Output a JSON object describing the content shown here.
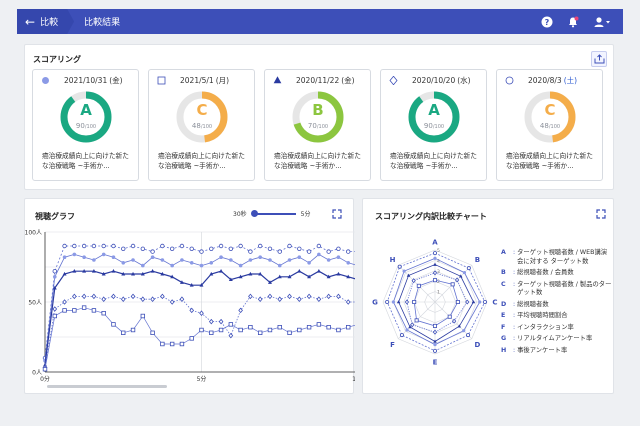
{
  "header": {
    "back_label": "比較",
    "current_label": "比較結果"
  },
  "scoring": {
    "title": "スコアリング",
    "cards": [
      {
        "marker": "dot",
        "date": "2021/10/31",
        "weekday": "(金)",
        "weekday_color": "#333333",
        "grade": "A",
        "score": "90",
        "max": "/100",
        "fraction": 0.9,
        "color": "#1aa882",
        "text": "癌治療成績向上に向けた新たな治療戦略 ~手術か..."
      },
      {
        "marker": "square",
        "date": "2021/5/1",
        "weekday": "(月)",
        "weekday_color": "#333333",
        "grade": "C",
        "score": "48",
        "max": "/100",
        "fraction": 0.48,
        "color": "#f4ad4a",
        "text": "癌治療成績向上に向けた新たな治療戦略 ~手術か..."
      },
      {
        "marker": "triangle",
        "date": "2020/11/22",
        "weekday": "(金)",
        "weekday_color": "#333333",
        "grade": "B",
        "score": "70",
        "max": "/100",
        "fraction": 0.7,
        "color": "#8cc63f",
        "text": "癌治療成績向上に向けた新たな治療戦略 ~手術か..."
      },
      {
        "marker": "diamond",
        "date": "2020/10/20",
        "weekday": "(水)",
        "weekday_color": "#333333",
        "grade": "A",
        "score": "90",
        "max": "/100",
        "fraction": 0.9,
        "color": "#1aa882",
        "text": "癌治療成績向上に向けた新たな治療戦略 ~手術か..."
      },
      {
        "marker": "circle",
        "date": "2020/8/3",
        "weekday": "(土)",
        "weekday_color": "#2a58d1",
        "grade": "C",
        "score": "48",
        "max": "/100",
        "fraction": 0.48,
        "color": "#f4ad4a",
        "text": "癌治療成績向上に向けた新たな治療戦略 ~手術か..."
      }
    ]
  },
  "graph": {
    "title": "視聴グラフ",
    "slider_min": "30秒",
    "slider_max": "5分"
  },
  "radar": {
    "title": "スコアリング内訳比較チャート",
    "legend": [
      {
        "key": "A",
        "text": "ターゲット視聴者数 / WEB講演会に対する ターゲット数"
      },
      {
        "key": "B",
        "text": "総視聴者数 / 会員数"
      },
      {
        "key": "C",
        "text": "ターゲット視聴者数 / 製品のターゲット数"
      },
      {
        "key": "D",
        "text": "総視聴者数"
      },
      {
        "key": "E",
        "text": "平均視聴時間割合"
      },
      {
        "key": "F",
        "text": "インタラクション率"
      },
      {
        "key": "G",
        "text": "リアルタイムアンケート率"
      },
      {
        "key": "H",
        "text": "事後アンケート率"
      }
    ]
  },
  "chart_data": [
    {
      "type": "line",
      "title": "視聴グラフ",
      "x_ticks": [
        "0分",
        "5分",
        "1"
      ],
      "y_ticks": [
        "0人",
        "50人",
        "100人"
      ],
      "ylim": [
        0,
        100
      ],
      "x_points": 33,
      "series": [
        {
          "marker": "circle",
          "values": [
            10,
            72,
            90,
            90,
            90,
            90,
            90,
            90,
            88,
            90,
            88,
            86,
            90,
            88,
            90,
            88,
            86,
            88,
            90,
            88,
            90,
            86,
            90,
            88,
            86,
            90,
            88,
            86,
            90,
            86,
            88,
            86,
            86
          ]
        },
        {
          "marker": "dot",
          "values": [
            8,
            68,
            82,
            84,
            82,
            80,
            84,
            82,
            78,
            80,
            76,
            82,
            80,
            76,
            80,
            78,
            76,
            78,
            82,
            80,
            76,
            80,
            82,
            80,
            76,
            80,
            82,
            78,
            84,
            80,
            82,
            78,
            76
          ]
        },
        {
          "marker": "triangle",
          "values": [
            5,
            60,
            70,
            72,
            72,
            72,
            70,
            72,
            70,
            70,
            70,
            72,
            70,
            68,
            64,
            62,
            62,
            70,
            72,
            66,
            68,
            70,
            70,
            64,
            68,
            68,
            72,
            68,
            72,
            68,
            70,
            68,
            66
          ]
        },
        {
          "marker": "diamond",
          "values": [
            3,
            45,
            50,
            54,
            54,
            54,
            52,
            54,
            52,
            54,
            52,
            52,
            54,
            50,
            52,
            44,
            42,
            36,
            36,
            26,
            44,
            54,
            52,
            54,
            52,
            54,
            52,
            54,
            52,
            54,
            54,
            50,
            50
          ]
        },
        {
          "marker": "square",
          "values": [
            2,
            40,
            44,
            44,
            46,
            44,
            42,
            34,
            28,
            30,
            40,
            28,
            20,
            20,
            20,
            24,
            30,
            28,
            30,
            34,
            30,
            32,
            28,
            30,
            32,
            28,
            30,
            32,
            34,
            32,
            30,
            32,
            34
          ]
        }
      ]
    },
    {
      "type": "radar",
      "title": "スコアリング内訳比較チャート",
      "axes": [
        "A",
        "B",
        "C",
        "D",
        "E",
        "F",
        "G",
        "H"
      ],
      "scale_labels": [
        "1",
        "2",
        "3",
        "4",
        "5"
      ],
      "rmax": 5,
      "series": [
        {
          "marker": "circle",
          "values": [
            4.7,
            4.6,
            4.8,
            4.5,
            4.7,
            4.5,
            4.6,
            4.8
          ]
        },
        {
          "marker": "dot",
          "values": [
            4.2,
            4.0,
            4.3,
            3.9,
            4.1,
            3.8,
            4.0,
            4.2
          ]
        },
        {
          "marker": "triangle",
          "values": [
            3.6,
            3.5,
            3.7,
            3.3,
            3.8,
            3.4,
            3.5,
            3.6
          ]
        },
        {
          "marker": "diamond",
          "values": [
            2.8,
            3.0,
            3.1,
            2.6,
            2.9,
            3.1,
            2.7,
            2.9
          ]
        },
        {
          "marker": "square",
          "values": [
            2.1,
            2.4,
            2.2,
            2.0,
            2.3,
            2.5,
            2.0,
            2.2
          ]
        }
      ]
    }
  ]
}
